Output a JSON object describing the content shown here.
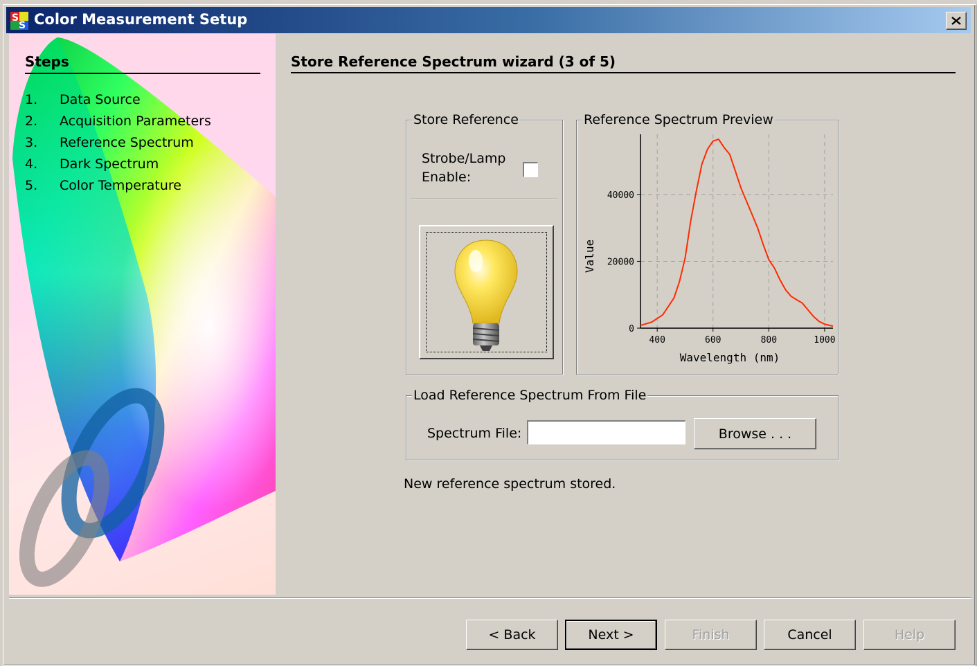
{
  "window": {
    "title": "Color Measurement Setup",
    "app_icon_text": "SS"
  },
  "steps": {
    "title": "Steps",
    "items": [
      {
        "num": "1.",
        "label": "Data Source"
      },
      {
        "num": "2.",
        "label": "Acquisition Parameters"
      },
      {
        "num": "3.",
        "label": "Reference Spectrum"
      },
      {
        "num": "4.",
        "label": "Dark Spectrum"
      },
      {
        "num": "5.",
        "label": "Color Temperature"
      }
    ]
  },
  "main": {
    "title": "Store Reference Spectrum wizard (3 of 5)",
    "store_reference": {
      "legend": "Store Reference",
      "strobe_label_line1": "Strobe/Lamp",
      "strobe_label_line2": "Enable:",
      "strobe_checked": false
    },
    "preview": {
      "legend": "Reference Spectrum Preview"
    },
    "load_file": {
      "legend": "Load Reference Spectrum From File",
      "spectrum_file_label": "Spectrum File:",
      "spectrum_file_value": "",
      "browse_label": "Browse . . ."
    },
    "status": "New reference spectrum stored."
  },
  "buttons": {
    "back": "< Back",
    "next": "Next >",
    "finish": "Finish",
    "cancel": "Cancel",
    "help": "Help"
  },
  "colors": {
    "title_start": "#0a246a",
    "title_end": "#a6caf0",
    "spectrum_line": "#ff2a00",
    "face": "#d4d0c8"
  },
  "chart_data": {
    "type": "line",
    "title": "",
    "xlabel": "Wavelength (nm)",
    "ylabel": "Value",
    "xlim": [
      340,
      1030
    ],
    "ylim": [
      0,
      58000
    ],
    "x_ticks": [
      400,
      600,
      800,
      1000
    ],
    "y_ticks": [
      0,
      20000,
      40000
    ],
    "grid": true,
    "series": [
      {
        "x": [
          340,
          380,
          420,
          460,
          480,
          500,
          520,
          540,
          560,
          580,
          600,
          620,
          640,
          660,
          680,
          700,
          720,
          740,
          760,
          780,
          800,
          820,
          840,
          860,
          880,
          900,
          920,
          940,
          960,
          980,
          1000,
          1030
        ],
        "y": [
          800,
          1800,
          4000,
          9000,
          14000,
          21000,
          32000,
          41000,
          49000,
          53500,
          56000,
          56500,
          54000,
          52000,
          47000,
          42000,
          38000,
          34000,
          30000,
          25000,
          20500,
          18000,
          14500,
          11500,
          9500,
          8500,
          7500,
          5500,
          3500,
          2000,
          1200,
          600
        ]
      }
    ]
  }
}
